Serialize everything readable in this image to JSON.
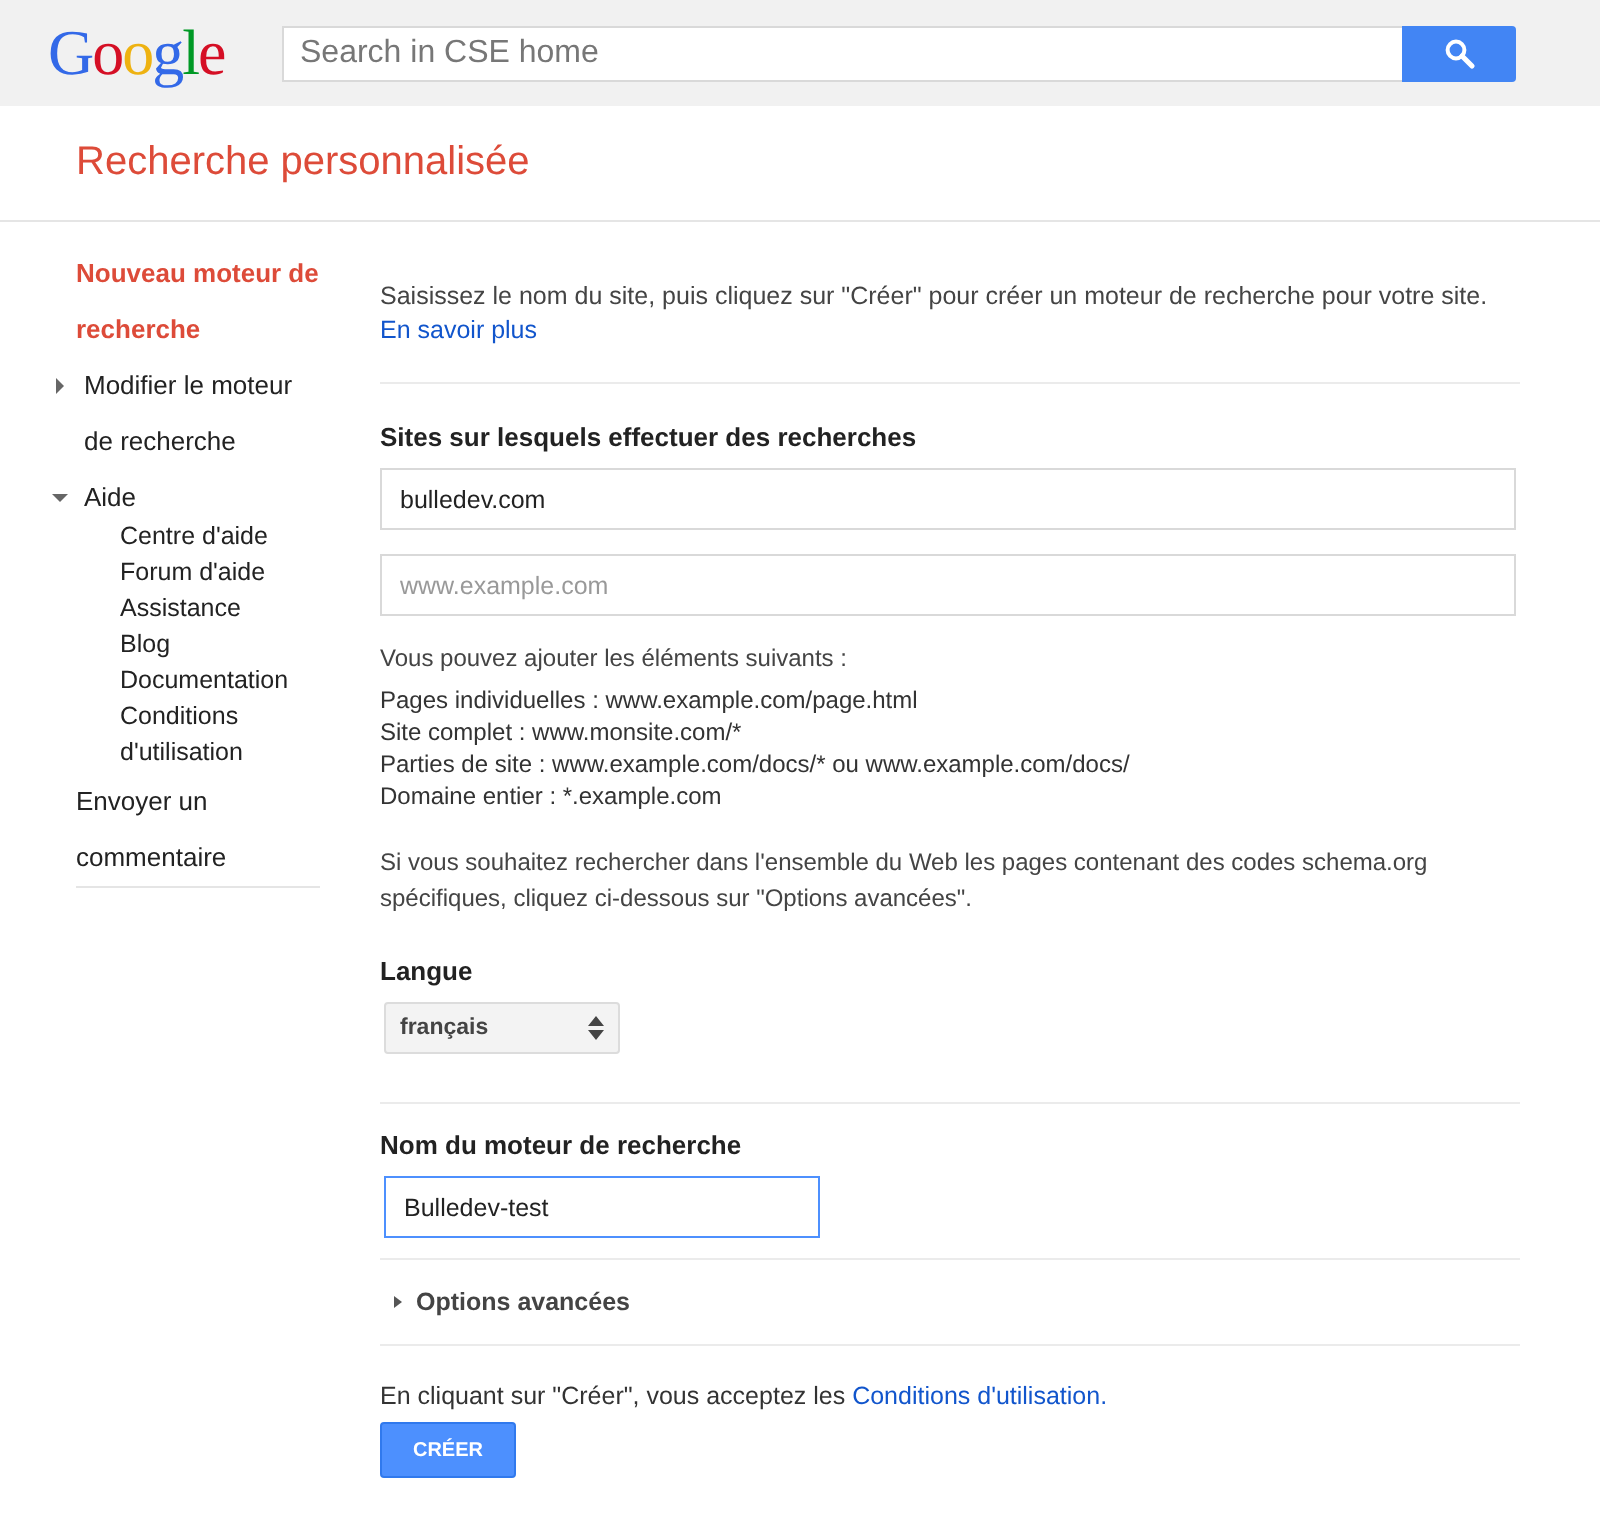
{
  "header": {
    "logo": "Google",
    "search": {
      "placeholder": "Search in CSE home"
    }
  },
  "page_title": "Recherche personnalisée",
  "sidebar": {
    "items": [
      {
        "kind": "link",
        "label": "Nouveau moteur de recherche",
        "selected": true
      },
      {
        "kind": "expandable",
        "label": "Modifier le moteur de recherche",
        "selected": false,
        "expanded": false
      },
      {
        "kind": "expandable",
        "label": "Aide",
        "selected": false,
        "expanded": true,
        "children": [
          {
            "label": "Centre d'aide"
          },
          {
            "label": "Forum d'aide"
          },
          {
            "label": "Assistance"
          },
          {
            "label": "Blog"
          },
          {
            "label": "Documentation"
          },
          {
            "label": "Conditions d'utilisation"
          }
        ]
      },
      {
        "kind": "link",
        "label": "Envoyer un commentaire",
        "selected": false
      }
    ]
  },
  "intro": {
    "text": "Saisissez le nom du site, puis cliquez sur \"Créer\" pour créer un moteur de recherche pour votre site.",
    "link": "En savoir plus"
  },
  "sites": {
    "heading": "Sites sur lesquels effectuer des recherches",
    "fields": [
      {
        "value": "bulledev.com"
      },
      {
        "placeholder": "www.example.com"
      }
    ],
    "hint_title": "Vous pouvez ajouter les éléments suivants :",
    "hints": [
      "Pages individuelles : www.example.com/page.html",
      "Site complet : www.monsite.com/*",
      "Parties de site : www.example.com/docs/* ou www.example.com/docs/",
      "Domaine entier : *.example.com"
    ],
    "schema_note": "Si vous souhaitez rechercher dans l'ensemble du Web les pages contenant des codes schema.org spécifiques, cliquez ci-dessous sur \"Options avancées\"."
  },
  "language": {
    "heading": "Langue",
    "value": "français"
  },
  "engine_name": {
    "heading": "Nom du moteur de recherche",
    "value": "Bulledev-test",
    "focused": true
  },
  "advanced_options": {
    "label": "Options avancées",
    "expanded": false
  },
  "terms": {
    "text": "En cliquant sur \"Créer\", vous acceptez les",
    "link": "Conditions d'utilisation."
  },
  "create_button": "CRÉER"
}
